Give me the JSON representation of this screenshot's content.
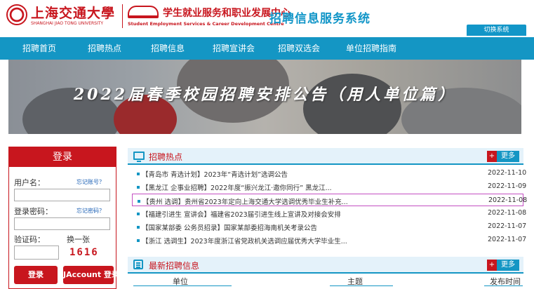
{
  "header": {
    "university_cn": "上海交通大學",
    "university_en": "SHANGHAI JIAO TONG UNIVERSITY",
    "center_cn": "学生就业服务和职业发展中心",
    "center_en": "Student Employment Services & Career Development Centre",
    "system_title": "招聘信息服务系统",
    "switch_label": "切换系统"
  },
  "nav": {
    "items": [
      "招聘首页",
      "招聘热点",
      "招聘信息",
      "招聘宣讲会",
      "招聘双选会",
      "单位招聘指南"
    ]
  },
  "banner": {
    "title": "2022届春季校园招聘安排公告（用人单位篇）"
  },
  "login": {
    "title": "登录",
    "username_label": "用户名：",
    "forgot_account": "忘记账号？",
    "password_label": "登录密码：",
    "forgot_password": "忘记密码？",
    "captcha_label": "验证码：",
    "refresh_label": "换一张",
    "captcha_value": "1616",
    "login_button": "登录",
    "jaccount_button": "JAccount 登录"
  },
  "hot": {
    "title": "招聘热点",
    "more_plus": "+",
    "more_label": "更多",
    "items": [
      {
        "title": "【青岛市 青选计划】2023年“青选计划”选调公告",
        "date": "2022-11-10"
      },
      {
        "title": "【黑龙江 企事业招聘】2022年度“振兴龙江·邀你同行” 黑龙江...",
        "date": "2022-11-09"
      },
      {
        "title": "【贵州 选调】贵州省2023年定向上海交通大学选调优秀毕业生补充...",
        "date": "2022-11-08"
      },
      {
        "title": "【福建引进生 宣讲会】福建省2023届引进生线上宣讲及对接会安排",
        "date": "2022-11-08"
      },
      {
        "title": "【国家某部委 公务员招录】国家某部委招海南机关考录公告",
        "date": "2022-11-07"
      },
      {
        "title": "【浙江 选调生】2023年度浙江省党政机关选调应届优秀大学毕业生...",
        "date": "2022-11-07"
      }
    ]
  },
  "latest": {
    "title": "最新招聘信息",
    "more_plus": "+",
    "more_label": "更多",
    "columns": [
      "单位",
      "主题",
      "发布时间"
    ]
  }
}
